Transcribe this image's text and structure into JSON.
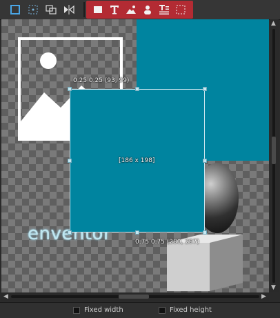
{
  "toolbar": {
    "left_tools": [
      {
        "icon": "select-rect-icon"
      },
      {
        "icon": "dotted-grid-icon"
      },
      {
        "icon": "overlap-rects-icon"
      },
      {
        "icon": "mirror-icon"
      }
    ],
    "right_tools": [
      {
        "icon": "rectangle-icon"
      },
      {
        "icon": "text-icon"
      },
      {
        "icon": "image-icon"
      },
      {
        "icon": "person-icon"
      },
      {
        "icon": "textblock-icon"
      },
      {
        "icon": "spacer-icon"
      }
    ],
    "accent_color": "#b32b33"
  },
  "canvas": {
    "logo_text": "enventor",
    "selection_color": "#00849f",
    "readout_top_left": "0.25 0.25 (93, 99)",
    "readout_size": "[186 x 198]",
    "readout_bottom_right": "0.75 0.75 (280, 297)"
  },
  "bottom_bar": {
    "fixed_width_label": "Fixed width",
    "fixed_height_label": "Fixed height"
  }
}
